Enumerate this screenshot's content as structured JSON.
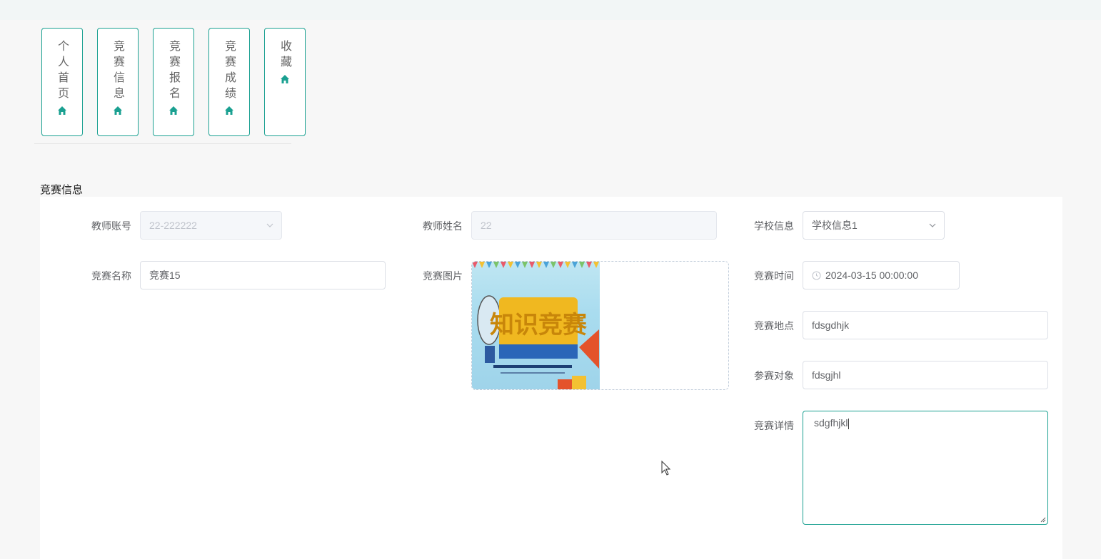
{
  "nav": {
    "items": [
      {
        "label": "个人首页",
        "icon": "home-icon"
      },
      {
        "label": "竞赛信息",
        "icon": "home-icon"
      },
      {
        "label": "竞赛报名",
        "icon": "home-icon"
      },
      {
        "label": "竞赛成绩",
        "icon": "home-icon"
      },
      {
        "label": "收藏",
        "icon": "home-icon"
      }
    ]
  },
  "section": {
    "title": "竞赛信息"
  },
  "form": {
    "teacher_account": {
      "label": "教师账号",
      "value": "22-222222"
    },
    "teacher_name": {
      "label": "教师姓名",
      "value": "22"
    },
    "school_info": {
      "label": "学校信息",
      "value": "学校信息1"
    },
    "contest_name": {
      "label": "竞赛名称",
      "value": "竞赛15"
    },
    "contest_image": {
      "label": "竞赛图片",
      "poster_text": "知识竞赛"
    },
    "contest_time": {
      "label": "竞赛时间",
      "value": "2024-03-15 00:00:00"
    },
    "contest_location": {
      "label": "竞赛地点",
      "value": "fdsgdhjk"
    },
    "participants": {
      "label": "参赛对象",
      "value": "fdsgjhl"
    },
    "contest_details": {
      "label": "竞赛详情",
      "value": "sdgfhjkl"
    }
  },
  "colors": {
    "accent": "#1aa091",
    "panel": "#ffffff",
    "background": "#f7f7f7"
  }
}
